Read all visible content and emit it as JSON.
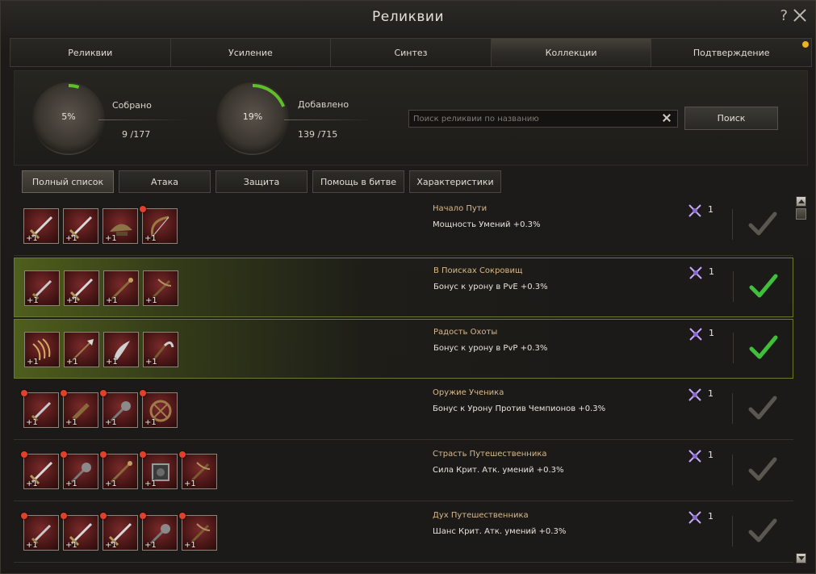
{
  "window": {
    "title": "Реликвии"
  },
  "tabs": [
    {
      "label": "Реликвии"
    },
    {
      "label": "Усиление"
    },
    {
      "label": "Синтез"
    },
    {
      "label": "Коллекции",
      "active": true
    },
    {
      "label": "Подтверждение",
      "notification": true
    }
  ],
  "stats": {
    "collected": {
      "percent_label": "5%",
      "progress": 0.05,
      "caption": "Собрано",
      "value": "9 /177"
    },
    "added": {
      "percent_label": "19%",
      "progress": 0.19,
      "caption": "Добавлено",
      "value": "139 /715"
    }
  },
  "search": {
    "placeholder": "Поиск реликвии по названию",
    "value": "",
    "button_label": "Поиск"
  },
  "filters": [
    {
      "label": "Полный список",
      "active": true
    },
    {
      "label": "Атака"
    },
    {
      "label": "Защита"
    },
    {
      "label": "Помощь в битве"
    },
    {
      "label": "Характеристики"
    }
  ],
  "colors": {
    "completed_check": "#3fbf3a",
    "incomplete_check": "#5a5750",
    "progress": "#5fbf2a",
    "name": "#d9b98a",
    "alert_dot": "#e2402a"
  },
  "collections": [
    {
      "name": "Начало Пути",
      "effect": "Мощность Умений +0.3%",
      "reward": "1",
      "completed": false,
      "items": [
        {
          "icon": "sword-icon",
          "level": "+1",
          "missing": false
        },
        {
          "icon": "sword-icon",
          "level": "+1",
          "missing": false
        },
        {
          "icon": "hat-icon",
          "level": "+1",
          "missing": false
        },
        {
          "icon": "bow-icon",
          "level": "+1",
          "missing": true
        }
      ]
    },
    {
      "name": "В Поисках Сокровищ",
      "effect": "Бонус к урону в PvE +0.3%",
      "reward": "1",
      "completed": true,
      "items": [
        {
          "icon": "dagger-icon",
          "level": "+1",
          "missing": false
        },
        {
          "icon": "sword-icon",
          "level": "+1",
          "missing": false
        },
        {
          "icon": "staff-icon",
          "level": "+1",
          "missing": false
        },
        {
          "icon": "crossbow-icon",
          "level": "+1",
          "missing": false
        }
      ]
    },
    {
      "name": "Радость Охоты",
      "effect": "Бонус к урону в PvP +0.3%",
      "reward": "1",
      "completed": true,
      "items": [
        {
          "icon": "claw-icon",
          "level": "+1",
          "missing": false
        },
        {
          "icon": "spear-icon",
          "level": "+1",
          "missing": false
        },
        {
          "icon": "blade-icon",
          "level": "+1",
          "missing": false
        },
        {
          "icon": "scythe-icon",
          "level": "+1",
          "missing": false
        }
      ]
    },
    {
      "name": "Оружие Ученика",
      "effect": "Бонус к Урону Против Чемпионов +0.3%",
      "reward": "1",
      "completed": false,
      "items": [
        {
          "icon": "dagger-icon",
          "level": "+1",
          "missing": true
        },
        {
          "icon": "club-icon",
          "level": "+1",
          "missing": true
        },
        {
          "icon": "mace-icon",
          "level": "+1",
          "missing": true
        },
        {
          "icon": "shield-icon",
          "level": "+1",
          "missing": true
        }
      ]
    },
    {
      "name": "Страсть Путешественника",
      "effect": "Сила Крит. Атк. умений +0.3%",
      "reward": "1",
      "completed": false,
      "items": [
        {
          "icon": "sword-icon",
          "level": "+1",
          "missing": true
        },
        {
          "icon": "mace-icon",
          "level": "+1",
          "missing": true
        },
        {
          "icon": "staff-icon",
          "level": "+1",
          "missing": true
        },
        {
          "icon": "orb-icon",
          "level": "+1",
          "missing": true
        },
        {
          "icon": "crossbow-icon",
          "level": "+1",
          "missing": true
        }
      ]
    },
    {
      "name": "Дух Путешественника",
      "effect": "Шанс Крит. Атк. умений +0.3%",
      "reward": "1",
      "completed": false,
      "items": [
        {
          "icon": "dagger-icon",
          "level": "+1",
          "missing": true
        },
        {
          "icon": "sword-icon",
          "level": "+1",
          "missing": true
        },
        {
          "icon": "sword-icon",
          "level": "+1",
          "missing": true
        },
        {
          "icon": "mace-icon",
          "level": "+1",
          "missing": true
        },
        {
          "icon": "crossbow-icon",
          "level": "+1",
          "missing": true
        }
      ]
    }
  ]
}
